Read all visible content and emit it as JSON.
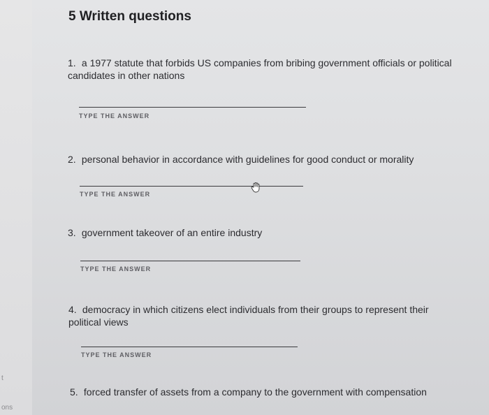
{
  "gutter": {
    "frag_top": "t",
    "frag_bottom": "ons"
  },
  "section": {
    "title": "5 Written questions"
  },
  "questions": [
    {
      "number": "1.",
      "text": "a 1977 statute that forbids US companies from bribing government officials or political candidates in other nations",
      "answer_value": "",
      "answer_label": "TYPE THE ANSWER"
    },
    {
      "number": "2.",
      "text": "personal behavior in accordance with guidelines for good conduct or morality",
      "answer_value": "",
      "answer_label": "TYPE THE ANSWER"
    },
    {
      "number": "3.",
      "text": "government takeover of an entire industry",
      "answer_value": "",
      "answer_label": "TYPE THE ANSWER"
    },
    {
      "number": "4.",
      "text": "democracy in which citizens elect individuals from their groups to represent their political views",
      "answer_value": "",
      "answer_label": "TYPE THE ANSWER"
    },
    {
      "number": "5.",
      "text": "forced transfer of assets from a company to the government with compensation"
    }
  ],
  "icons": {
    "cursor": "hand-cursor-icon"
  }
}
